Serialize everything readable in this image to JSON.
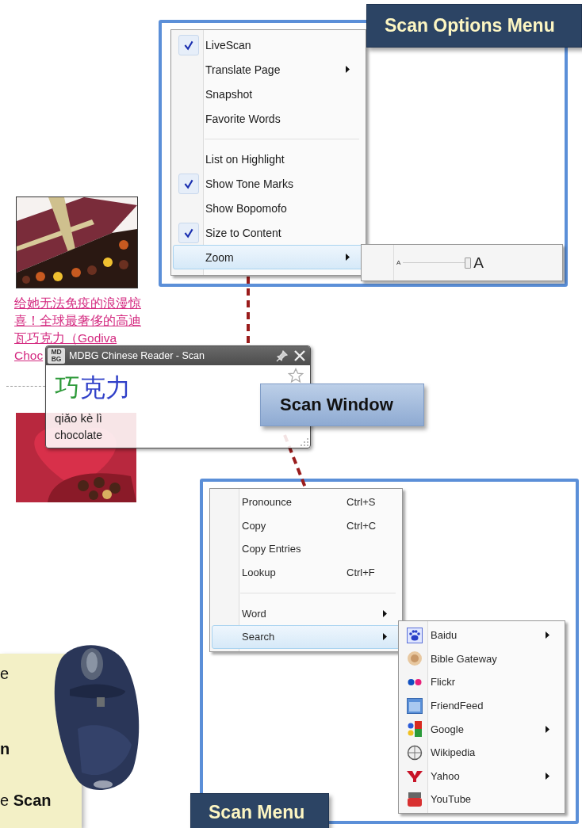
{
  "scan_options_menu": {
    "label": "Scan Options Menu",
    "groups": [
      [
        {
          "text": "LiveScan",
          "checked": true,
          "submenu": false,
          "selected": false
        },
        {
          "text": "Translate Page",
          "checked": false,
          "submenu": true,
          "selected": false
        },
        {
          "text": "Snapshot",
          "checked": false,
          "submenu": false,
          "selected": false
        },
        {
          "text": "Favorite Words",
          "checked": false,
          "submenu": false,
          "selected": false
        }
      ],
      [
        {
          "text": "List on Highlight",
          "checked": false,
          "submenu": false,
          "selected": false
        },
        {
          "text": "Show Tone Marks",
          "checked": true,
          "submenu": false,
          "selected": false
        },
        {
          "text": "Show Bopomofo",
          "checked": false,
          "submenu": false,
          "selected": false
        },
        {
          "text": "Size to Content",
          "checked": true,
          "submenu": false,
          "selected": false
        },
        {
          "text": "Zoom",
          "checked": false,
          "submenu": true,
          "selected": true
        }
      ]
    ],
    "zoom_submenu": {
      "small_label": "A",
      "large_label": "A",
      "slider": {
        "level": 1
      }
    }
  },
  "link": "给她无法免疫的浪漫惊喜！全球最奢侈的高迪瓦巧克力（Godiva Choc",
  "scan_window": {
    "title": "MDBG Chinese Reader - Scan",
    "logo": "MDBG",
    "favorite": false,
    "headword": [
      {
        "char": "巧",
        "color": "#2e9a3a"
      },
      {
        "char": "克",
        "color": "#3040c8"
      },
      {
        "char": "力",
        "color": "#3040c8"
      }
    ],
    "pinyin": "qiǎo kè lì",
    "definition": "chocolate",
    "label": "Scan Window"
  },
  "scan_menu": {
    "label": "Scan Menu",
    "groups": [
      [
        {
          "text": "Pronounce",
          "shortcut": "Ctrl+S",
          "submenu": false,
          "selected": false
        },
        {
          "text": "Copy",
          "shortcut": "Ctrl+C",
          "submenu": false,
          "selected": false
        },
        {
          "text": "Copy Entries",
          "submenu": false,
          "selected": false
        },
        {
          "text": "Lookup",
          "shortcut": "Ctrl+F",
          "submenu": false,
          "selected": false
        }
      ],
      [
        {
          "text": "Word",
          "submenu": true,
          "selected": false
        },
        {
          "text": "Search",
          "submenu": true,
          "selected": true
        }
      ]
    ],
    "search_submenu": [
      {
        "text": "Baidu",
        "submenu": true,
        "selected": false
      },
      {
        "text": "Bible Gateway",
        "submenu": false,
        "selected": false
      },
      {
        "text": "Flickr",
        "submenu": false,
        "selected": false
      },
      {
        "text": "FriendFeed",
        "submenu": false,
        "selected": false
      },
      {
        "text": "Google",
        "submenu": true,
        "selected": false
      },
      {
        "text": "Wikipedia",
        "submenu": false,
        "selected": false
      },
      {
        "text": "Yahoo",
        "submenu": true,
        "selected": false
      },
      {
        "text": "YouTube",
        "submenu": false,
        "selected": false
      }
    ]
  },
  "note": [
    {
      "text": "e",
      "bold": false
    },
    {
      "text": "n",
      "bold": true
    },
    {
      "text": "e **Scan**",
      "bold": false
    }
  ]
}
